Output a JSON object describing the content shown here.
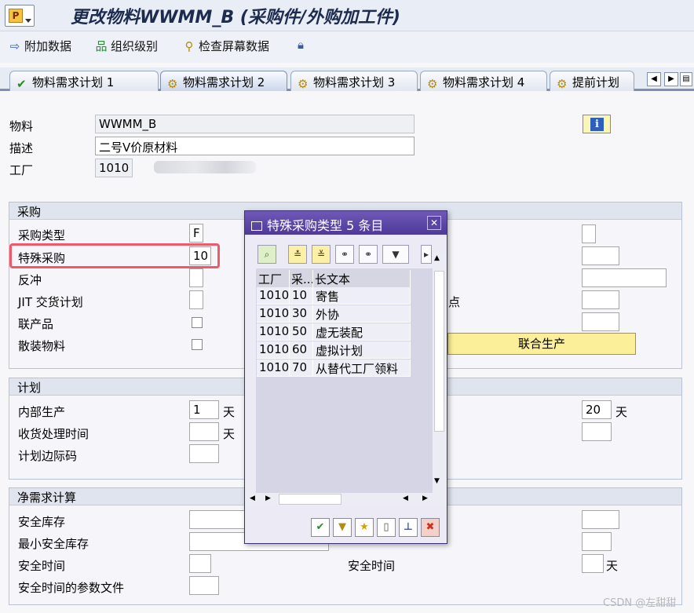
{
  "window": {
    "title": "更改物料WWMM_B (采购件/外购加工件)"
  },
  "toolbar": {
    "items": [
      "附加数据",
      "组织级别",
      "检查屏幕数据"
    ]
  },
  "tabs": [
    "物料需求计划 1",
    "物料需求计划 2",
    "物料需求计划 3",
    "物料需求计划 4",
    "提前计划"
  ],
  "header": {
    "material_label": "物料",
    "material_value": "WWMM_B",
    "desc_label": "描述",
    "desc_value": "二号V价原材料",
    "plant_label": "工厂",
    "plant_value": "1010"
  },
  "procurement": {
    "title": "采购",
    "type_label": "采购类型",
    "type_value": "F",
    "special_label": "特殊采购",
    "special_value": "10",
    "backflush_label": "反冲",
    "jit_label": "JIT 交货计划",
    "coproduct_label": "联产品",
    "bulk_label": "散装物料",
    "right_fragment": "点",
    "joint_production_button": "联合生产"
  },
  "planning": {
    "title": "计划",
    "inhouse_label": "内部生产",
    "inhouse_value": "1",
    "unit_day": "天",
    "gr_label": "收货处理时间",
    "margin_label": "计划边际码",
    "right_value": "20"
  },
  "net_requirements": {
    "title": "净需求计算",
    "safety_stock_label": "安全库存",
    "min_safety_stock_label": "最小安全库存",
    "safety_time_label": "安全时间",
    "safety_profile_label": "安全时间的参数文件",
    "right_safety_time_label": "安全时间"
  },
  "popup": {
    "title": "特殊采购类型 5 条目",
    "columns": [
      "工厂",
      "采...",
      "长文本"
    ],
    "rows": [
      [
        "1010",
        "10",
        "寄售"
      ],
      [
        "1010",
        "30",
        "外协"
      ],
      [
        "1010",
        "50",
        "虚无装配"
      ],
      [
        "1010",
        "60",
        "虚拟计划"
      ],
      [
        "1010",
        "70",
        "从替代工厂领料"
      ]
    ]
  },
  "watermark": "CSDN @左甜甜"
}
